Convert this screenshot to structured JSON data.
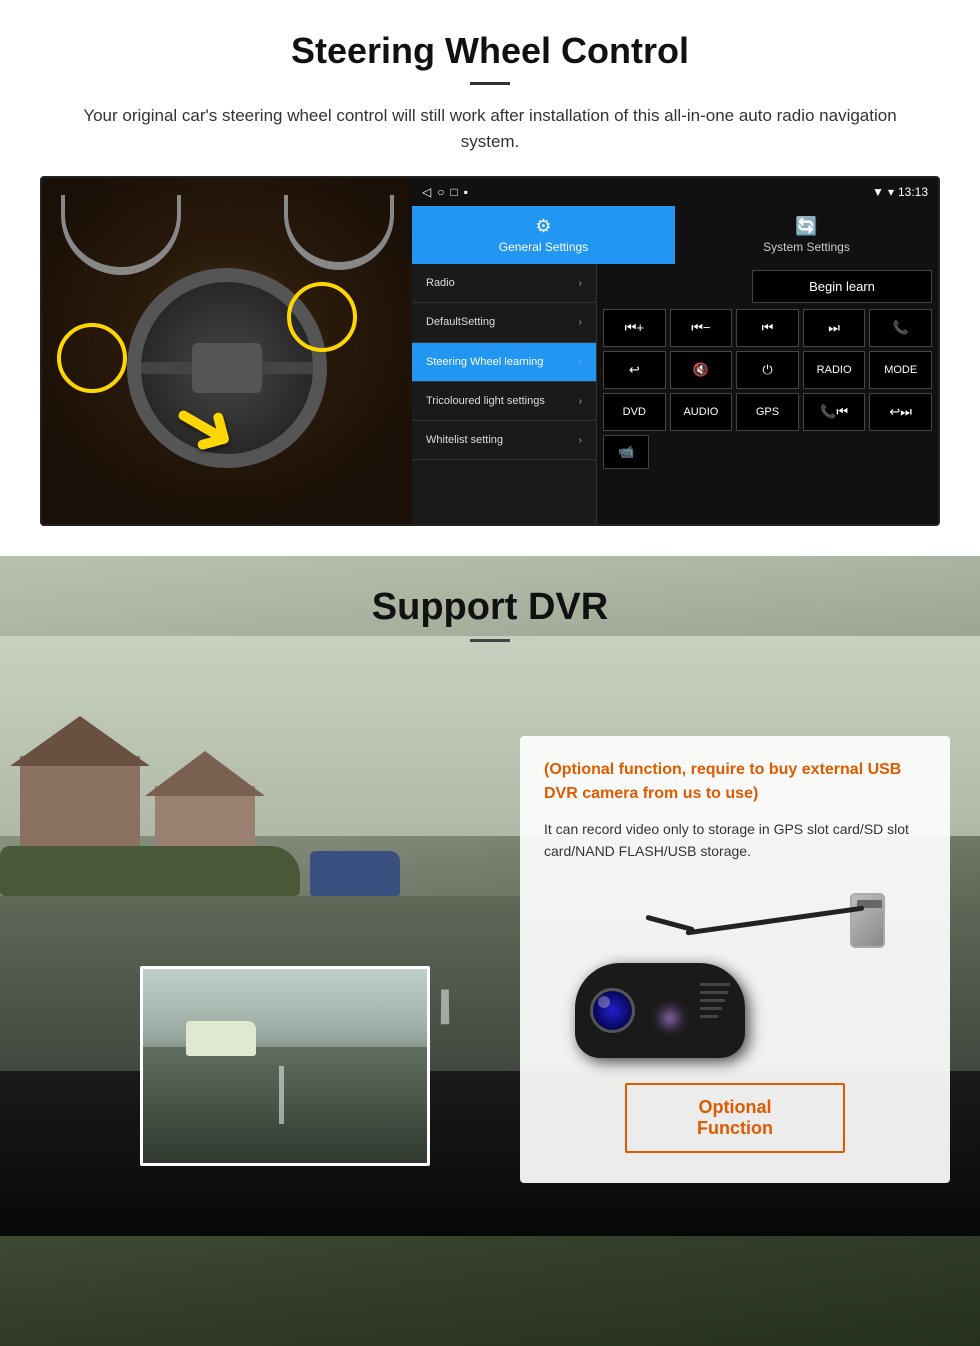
{
  "steering": {
    "title": "Steering Wheel Control",
    "subtitle": "Your original car's steering wheel control will still work after installation of this all-in-one auto radio navigation system.",
    "tabs": {
      "general_icon": "⚙",
      "general_label": "General Settings",
      "system_icon": "🔄",
      "system_label": "System Settings"
    },
    "status_bar": {
      "signal": "▼",
      "wifi": "▾",
      "time": "13:13"
    },
    "nav_icons": [
      "◁",
      "○",
      "□",
      "▪"
    ],
    "menu_items": [
      {
        "label": "Radio",
        "active": false
      },
      {
        "label": "DefaultSetting",
        "active": false
      },
      {
        "label": "Steering Wheel learning",
        "active": true
      },
      {
        "label": "Tricoloured light settings",
        "active": false
      },
      {
        "label": "Whitelist setting",
        "active": false
      }
    ],
    "begin_learn": "Begin learn",
    "control_buttons": [
      "⏮+",
      "⏮−",
      "⏮⏮",
      "⏭⏭",
      "📞",
      "↩",
      "🔇×",
      "⏻",
      "RADIO",
      "MODE",
      "DVD",
      "AUDIO",
      "GPS",
      "📞⏮",
      "↩⏭"
    ],
    "bottom_icon": "📹"
  },
  "dvr": {
    "title": "Support DVR",
    "optional_text": "(Optional function, require to buy external USB DVR camera from us to use)",
    "description": "It can record video only to storage in GPS slot card/SD slot card/NAND FLASH/USB storage.",
    "optional_fn_label": "Optional Function"
  }
}
